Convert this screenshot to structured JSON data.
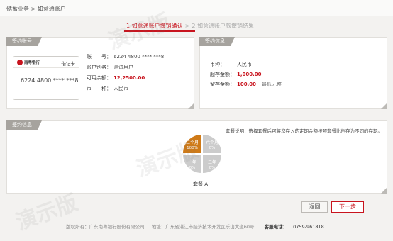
{
  "breadcrumb": "储蓄业务 > 如意通账户",
  "steps": {
    "step1": "1.如意通账户撤销确认",
    "separator": ">",
    "step2": "2.如意通账户款撤销结果"
  },
  "account_panel": {
    "tag": "签约账号",
    "card": {
      "bank_name": "南粤银行",
      "card_type": "借记卡",
      "card_number": "6224 4800 **** ***8"
    },
    "rows": [
      {
        "label": "账　　号：",
        "value": "6224 4800 **** ***8"
      },
      {
        "label": "账户别名：",
        "value": "测试用户"
      },
      {
        "label": "可用余额：",
        "value": "12,2500.00"
      },
      {
        "label": "币　　种：",
        "value": "人民币"
      }
    ]
  },
  "info_panel": {
    "tag": "签约信息",
    "rows": [
      {
        "label": "币种：",
        "value": "人民币"
      },
      {
        "label": "起存金额：",
        "value": "1,000.00"
      },
      {
        "label": "留存金额：",
        "value": "100.00",
        "note": "最低元整"
      }
    ]
  },
  "package_panel": {
    "tag": "签约信息",
    "description": "套餐说明：选择套餐后可将您存入的定期金额按照套餐比例存为不同的存期。",
    "package_name": "套餐 A",
    "quadrants": [
      {
        "name": "三个月",
        "percent": "100%",
        "active": true
      },
      {
        "name": "六个月",
        "percent": "0%",
        "active": false
      },
      {
        "name": "一年",
        "percent": "0%",
        "active": false
      },
      {
        "name": "二年",
        "percent": "0%",
        "active": false
      }
    ]
  },
  "buttons": {
    "back": "返回",
    "next": "下一步"
  },
  "footer": {
    "copyright": "版权所有：广东南粤银行股份有限公司",
    "address": "地址：广东省湛江市经济技术开发区乐山大道60号",
    "phone_label": "客服电话：",
    "phone": "0759-961818"
  },
  "watermark_text": "演示版",
  "colors": {
    "accent_red": "#c8141e",
    "active_orange": "#cf7a17",
    "tag_gray": "#a6a39e"
  }
}
